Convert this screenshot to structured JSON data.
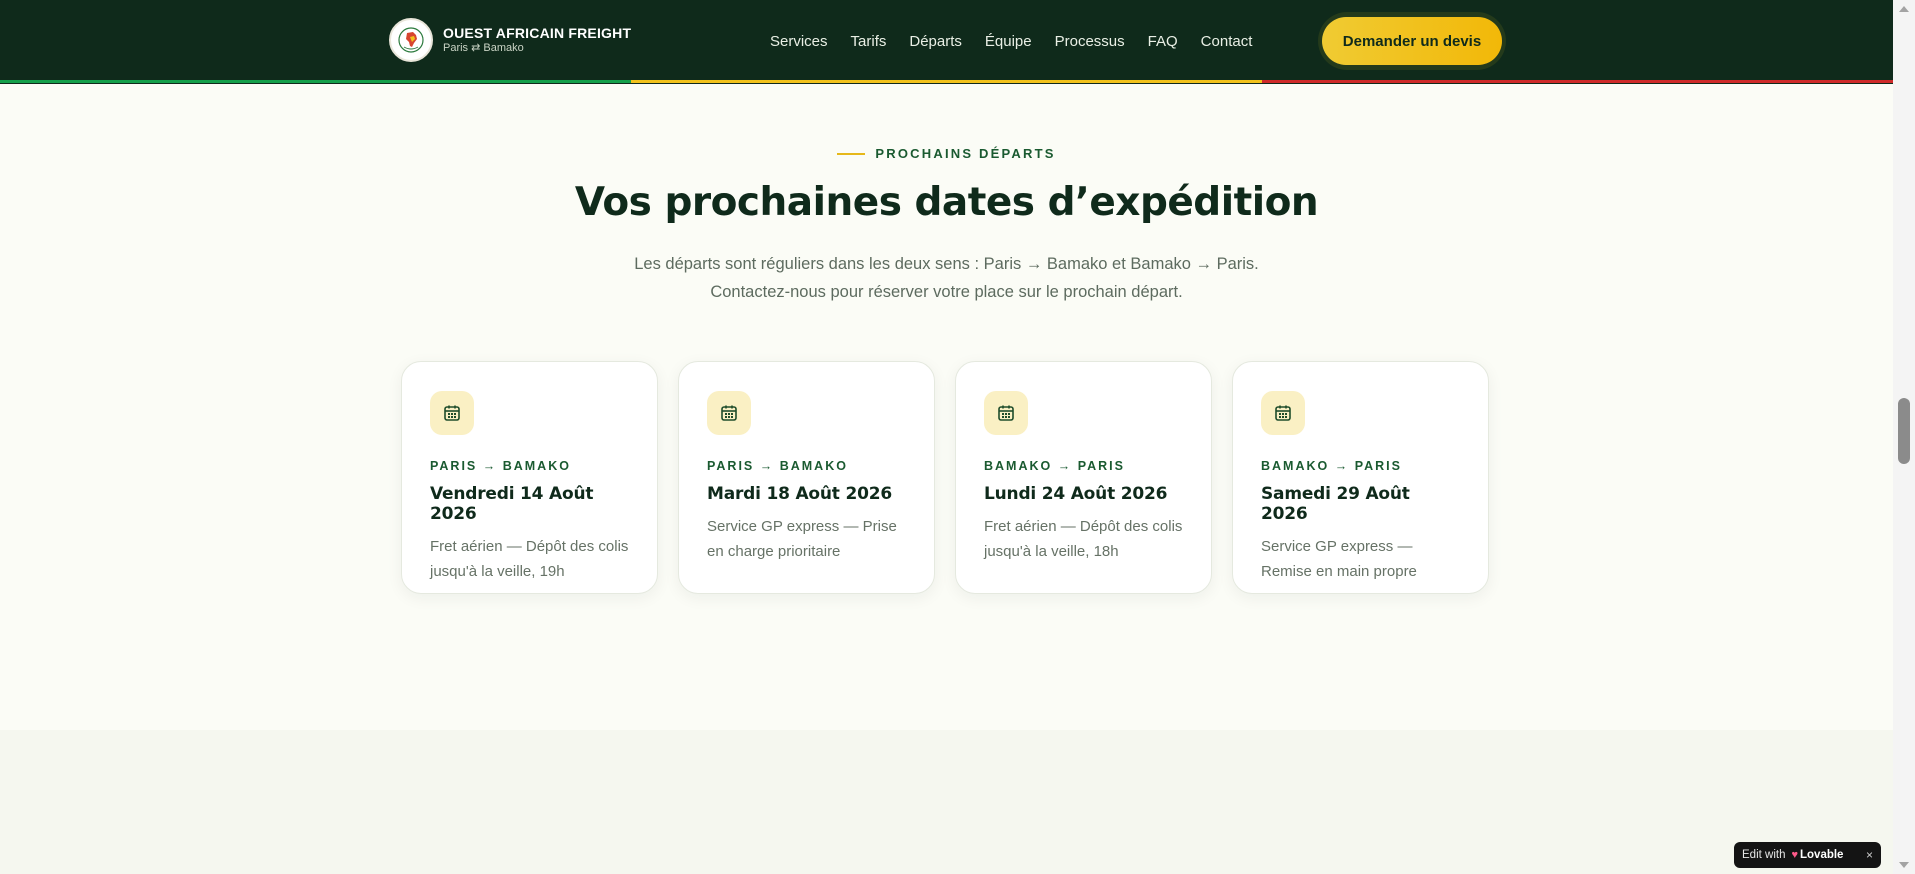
{
  "header": {
    "brand_title": "OUEST AFRICAIN FREIGHT",
    "brand_sub": "Paris ⇄ Bamako",
    "nav": [
      "Services",
      "Tarifs",
      "Départs",
      "Équipe",
      "Processus",
      "FAQ",
      "Contact"
    ],
    "cta": "Demander un devis",
    "flag_colors": [
      "#14a04a",
      "#f2c21c",
      "#cf2a2a"
    ]
  },
  "section": {
    "eyebrow": "PROCHAINS DÉPARTS",
    "title": "Vos prochaines dates d’expédition",
    "intro_line1": "Les départs sont réguliers dans les deux sens : Paris → Bamako et Bamako → Paris.",
    "intro_line2": "Contactez-nous pour réserver votre place sur le prochain départ."
  },
  "departures": [
    {
      "route": "PARIS → BAMAKO",
      "date": "Vendredi 14 Août 2026",
      "desc": "Fret aérien — Dépôt des colis jusqu'à la veille, 19h",
      "icon": "calendar-icon"
    },
    {
      "route": "PARIS → BAMAKO",
      "date": "Mardi 18 Août 2026",
      "desc": "Service GP express — Prise en charge prioritaire",
      "icon": "calendar-icon"
    },
    {
      "route": "BAMAKO → PARIS",
      "date": "Lundi 24 Août 2026",
      "desc": "Fret aérien — Dépôt des colis jusqu'à la veille, 18h",
      "icon": "calendar-icon"
    },
    {
      "route": "BAMAKO → PARIS",
      "date": "Samedi 29 Août 2026",
      "desc": "Service GP express — Remise en main propre",
      "icon": "calendar-icon"
    }
  ],
  "badge": {
    "prefix": "Edit with",
    "brand": "Lovable",
    "close": "×"
  }
}
